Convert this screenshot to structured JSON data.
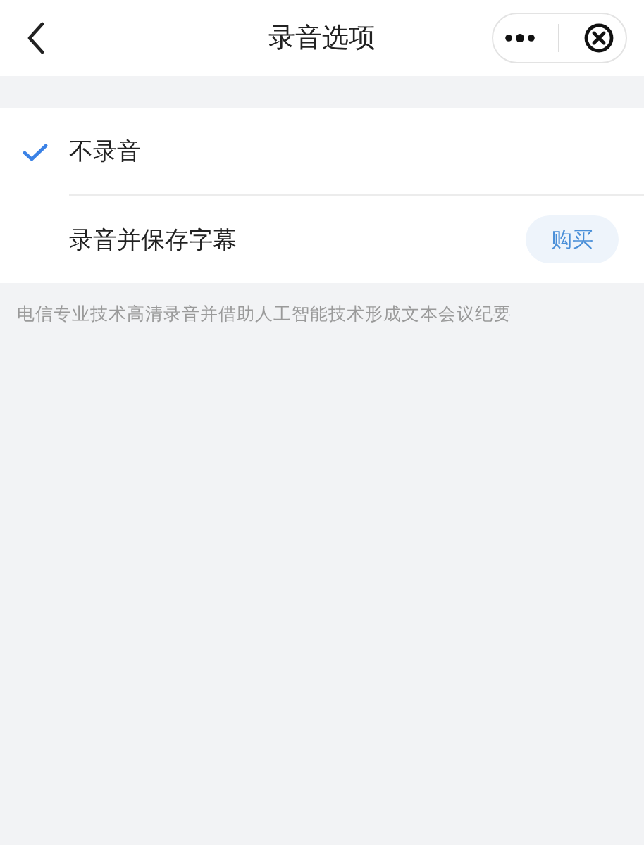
{
  "header": {
    "title": "录音选项"
  },
  "options": [
    {
      "label": "不录音",
      "selected": true
    },
    {
      "label": "录音并保存字幕",
      "selected": false,
      "action": "购买"
    }
  ],
  "note": "电信专业技术高清录音并借助人工智能技术形成文本会议纪要"
}
